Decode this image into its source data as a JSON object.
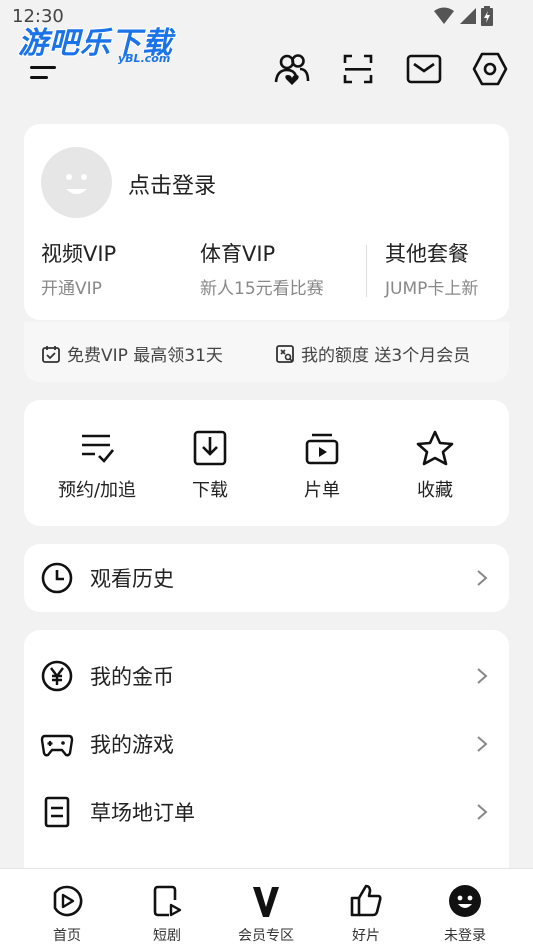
{
  "status_bar": {
    "time": "12:30"
  },
  "watermark": {
    "title": "游吧乐下载",
    "subtitle": "yBL.com"
  },
  "profile": {
    "login_label": "点击登录"
  },
  "vip": [
    {
      "title": "视频VIP",
      "subtitle": "开通VIP"
    },
    {
      "title": "体育VIP",
      "subtitle": "新人15元看比赛"
    },
    {
      "title": "其他套餐",
      "subtitle": "JUMP卡上新"
    }
  ],
  "promos": [
    {
      "label": "免费VIP 最高领31天",
      "icon": "calendar-check-icon"
    },
    {
      "label": "我的额度 送3个月会员",
      "icon": "quota-search-icon"
    }
  ],
  "quick_actions": [
    {
      "label": "预约/加追",
      "icon": "list-check-icon"
    },
    {
      "label": "下载",
      "icon": "download-icon"
    },
    {
      "label": "片单",
      "icon": "playlist-icon"
    },
    {
      "label": "收藏",
      "icon": "star-icon"
    }
  ],
  "history": {
    "label": "观看历史",
    "icon": "clock-icon"
  },
  "list_items": [
    {
      "label": "我的金币",
      "icon": "yen-coin-icon"
    },
    {
      "label": "我的游戏",
      "icon": "gamepad-icon"
    },
    {
      "label": "草场地订单",
      "icon": "order-doc-icon"
    }
  ],
  "bottom_nav": [
    {
      "label": "首页",
      "icon": "home-play-icon"
    },
    {
      "label": "短剧",
      "icon": "short-drama-icon"
    },
    {
      "label": "会员专区",
      "icon": "vip-v-icon"
    },
    {
      "label": "好片",
      "icon": "thumbs-up-icon"
    },
    {
      "label": "未登录",
      "icon": "user-face-icon"
    }
  ]
}
